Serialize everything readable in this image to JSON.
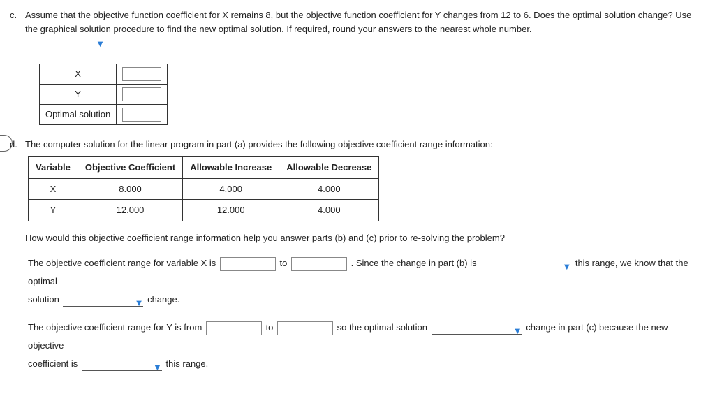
{
  "partC": {
    "label": "c.",
    "text": "Assume that the objective function coefficient for X remains 8, but the objective function coefficient for Y changes from 12 to 6. Does the optimal solution change? Use the graphical solution procedure to find the new optimal solution. If required, round your answers to the nearest whole number.",
    "table": {
      "row1": "X",
      "row2": "Y",
      "row3": "Optimal solution"
    }
  },
  "partD": {
    "label": "d.",
    "intro": "The computer solution for the linear program in part (a) provides the following objective coefficient range information:",
    "headers": [
      "Variable",
      "Objective Coefficient",
      "Allowable Increase",
      "Allowable Decrease"
    ],
    "rows": [
      [
        "X",
        "8.000",
        "4.000",
        "4.000"
      ],
      [
        "Y",
        "12.000",
        "12.000",
        "4.000"
      ]
    ],
    "q1": "How would this objective coefficient range information help you answer parts (b) and (c) prior to re-solving the problem?",
    "sentence1a": "The objective coefficient range for variable X is",
    "sentence1b": "to",
    "sentence1c": ". Since the change in part (b) is",
    "sentence1d": "this range, we know that the optimal",
    "sentence1_line2a": "solution",
    "sentence1_line2b": "change.",
    "sentence2a": "The objective coefficient range for Y is from",
    "sentence2b": "to",
    "sentence2c": "so the optimal solution",
    "sentence2d": "change in part (c) because the new objective",
    "sentence2_line2a": "coefficient is",
    "sentence2_line2b": "this range."
  }
}
